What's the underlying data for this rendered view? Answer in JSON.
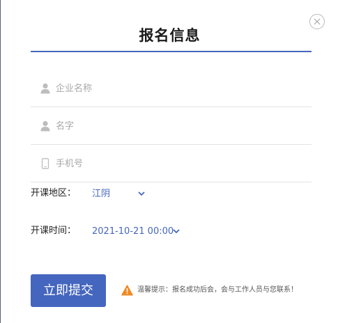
{
  "dialog": {
    "title": "报名信息",
    "close_icon": "close-icon"
  },
  "form": {
    "company": {
      "placeholder": "企业名称",
      "value": "",
      "icon": "user-icon"
    },
    "name": {
      "placeholder": "名字",
      "value": "",
      "icon": "user-icon"
    },
    "phone": {
      "placeholder": "手机号",
      "value": "",
      "icon": "phone-icon"
    },
    "region": {
      "label": "开课地区：",
      "value": "江阴",
      "icon": "chevron-down-icon"
    },
    "time": {
      "label": "开课时间：",
      "value": "2021-10-21 00:00",
      "icon": "chevron-down-icon"
    }
  },
  "actions": {
    "submit_label": "立即提交"
  },
  "tip": {
    "icon": "warning-icon",
    "text": "温馨提示：报名成功后会，会与工作人员与您联系！"
  },
  "colors": {
    "accent": "#4566be",
    "warning": "#f08a24",
    "placeholder": "#a8a8a8",
    "divider": "#e3e3e3"
  }
}
